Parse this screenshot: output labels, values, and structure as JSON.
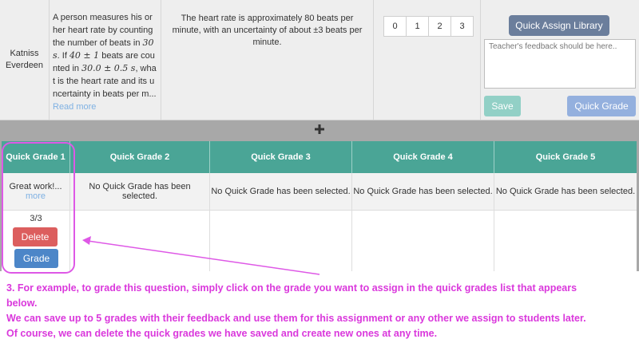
{
  "student": {
    "name": "Katniss Everdeen"
  },
  "question": {
    "text_before": "A person measures his or her heart rate by counting the number of beats in ",
    "math1": "30 s",
    "text_mid1": ". If ",
    "math2": "40 ± 1",
    "text_mid2": " beats are counted in ",
    "math3": "30.0 ± 0.5 s",
    "text_after": ", what is the heart rate and its uncertainty in beats per m...",
    "read_more": "Read more"
  },
  "answer": {
    "text": "The heart rate is approximately 80 beats per minute, with an uncertainty of about ±3 beats per minute."
  },
  "points": [
    "0",
    "1",
    "2",
    "3"
  ],
  "feedback": {
    "library_button": "Quick Assign Library",
    "placeholder": "Teacher's feedback should be here..",
    "save_button": "Save",
    "quick_grade_button": "Quick Grade"
  },
  "divider": {
    "icon": "plus-icon"
  },
  "quick_grades": {
    "headers": [
      "Quick Grade 1",
      "Quick Grade 2",
      "Quick Grade 3",
      "Quick Grade 4",
      "Quick Grade 5"
    ],
    "feedback": [
      "Great work!...",
      "No Quick Grade has been selected.",
      "No Quick Grade has been selected.",
      "No Quick Grade has been selected.",
      "No Quick Grade has been selected."
    ],
    "more": "more",
    "score": "3/3",
    "delete_button": "Delete",
    "grade_button": "Grade"
  },
  "annotation": {
    "color": "#da38dc",
    "lines": [
      "3. For example, to grade this question, simply click on the grade you want to assign in the quick grades list that appears",
      "below.",
      "We can save up to 5 grades with their feedback and use them for this assignment or any other we assign to students later.",
      "Of course, we can delete the quick grades we have saved and create new ones at any time."
    ]
  },
  "colors": {
    "header_teal": "#4aa596",
    "library_btn": "#6b7e9c",
    "save_btn": "#92d0c6",
    "quick_grade_btn": "#94b0de",
    "delete_btn": "#dc5e5e",
    "grade_btn": "#4c86c8",
    "link": "#7fb1e3"
  }
}
